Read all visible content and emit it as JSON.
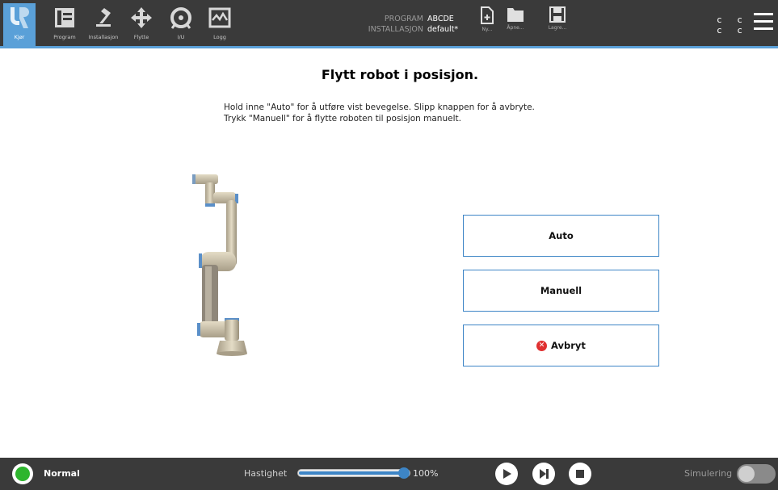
{
  "nav": {
    "items": [
      {
        "label": "Kjør",
        "icon": "ur-logo-icon",
        "active": true
      },
      {
        "label": "Program",
        "icon": "program-icon",
        "active": false
      },
      {
        "label": "Installasjon",
        "icon": "installation-icon",
        "active": false
      },
      {
        "label": "Flytte",
        "icon": "move-icon",
        "active": false
      },
      {
        "label": "I/U",
        "icon": "io-icon",
        "active": false
      },
      {
        "label": "Logg",
        "icon": "log-icon",
        "active": false
      }
    ]
  },
  "program_info": {
    "program_key": "PROGRAM",
    "program_value": "ABCDE",
    "installation_key": "INSTALLASJON",
    "installation_value": "default*"
  },
  "file_buttons": {
    "new_label": "Ny...",
    "open_label": "Åpne...",
    "save_label": "Lagre..."
  },
  "top_right": {
    "cc_line1": "c c",
    "cc_line2": "c c"
  },
  "main": {
    "title": "Flytt robot i posisjon.",
    "instruction_line1": "Hold inne \"Auto\" for å utføre vist bevegelse. Slipp knappen for å avbryte.",
    "instruction_line2": "Trykk \"Manuell\" for å flytte roboten til posisjon manuelt.",
    "auto_label": "Auto",
    "manual_label": "Manuell",
    "cancel_label": "Avbryt"
  },
  "bottom": {
    "status": "Normal",
    "speed_label": "Hastighet",
    "speed_value": "100%",
    "speed_fraction": 1.0,
    "simulation_label": "Simulering"
  },
  "colors": {
    "accent": "#5aa0d8",
    "button_border": "#3d85c6",
    "status_ok": "#2db52d",
    "cancel_red": "#e03030"
  }
}
